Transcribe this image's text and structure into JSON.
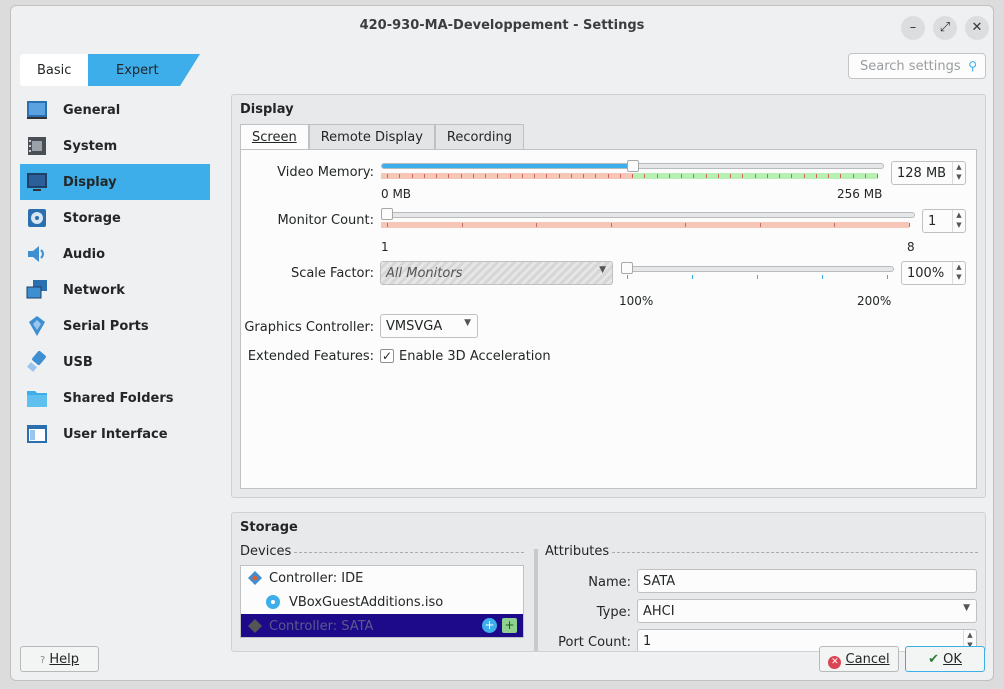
{
  "window": {
    "title": "420-930-MA-Developpement - Settings",
    "controls": {
      "minimize": "–",
      "maximize": "⤢",
      "close": "✕"
    }
  },
  "mode_tabs": {
    "basic": "Basic",
    "expert": "Expert",
    "selected": "Expert"
  },
  "search": {
    "placeholder": "Search settings"
  },
  "sidebar": {
    "items": [
      {
        "label": "General",
        "icon": "general-icon"
      },
      {
        "label": "System",
        "icon": "system-icon"
      },
      {
        "label": "Display",
        "icon": "display-icon",
        "selected": true
      },
      {
        "label": "Storage",
        "icon": "storage-icon"
      },
      {
        "label": "Audio",
        "icon": "audio-icon"
      },
      {
        "label": "Network",
        "icon": "network-icon"
      },
      {
        "label": "Serial Ports",
        "icon": "serial-ports-icon"
      },
      {
        "label": "USB",
        "icon": "usb-icon"
      },
      {
        "label": "Shared Folders",
        "icon": "shared-folders-icon"
      },
      {
        "label": "User Interface",
        "icon": "user-interface-icon"
      }
    ]
  },
  "display": {
    "title": "Display",
    "tabs": [
      "Screen",
      "Remote Display",
      "Recording"
    ],
    "active_tab": "Screen",
    "video_memory": {
      "label": "Video Memory:",
      "value": "128 MB",
      "min": "0 MB",
      "max": "256 MB",
      "fraction": 0.5
    },
    "monitor_count": {
      "label": "Monitor Count:",
      "value": "1",
      "min": "1",
      "max": "8",
      "fraction": 0.0
    },
    "scale_factor": {
      "label": "Scale Factor:",
      "combo": "All Monitors",
      "value": "100%",
      "min": "100%",
      "max": "200%",
      "fraction": 0.0
    },
    "graphics_controller": {
      "label": "Graphics Controller:",
      "value": "VMSVGA"
    },
    "extended_features": {
      "label": "Extended Features:",
      "checkbox_label": "Enable 3D Acceleration",
      "checked": true
    }
  },
  "storage": {
    "title": "Storage",
    "devices_label": "Devices",
    "attributes_label": "Attributes",
    "tree": [
      {
        "label": "Controller: IDE",
        "icon": "ide-controller-icon",
        "level": 0
      },
      {
        "label": "VBoxGuestAdditions.iso",
        "icon": "optical-disc-icon",
        "level": 1
      },
      {
        "label": "Controller: SATA",
        "icon": "sata-controller-icon",
        "level": 0,
        "selected": true
      }
    ],
    "attributes": {
      "name_label": "Name:",
      "name_value": "SATA",
      "type_label": "Type:",
      "type_value": "AHCI",
      "port_count_label": "Port Count:",
      "port_count_value": "1"
    }
  },
  "buttons": {
    "help": "Help",
    "cancel": "Cancel",
    "ok": "OK"
  },
  "colors": {
    "accent": "#3daee9",
    "selection_dark": "#1d0a8a",
    "zone_red": "#f6c6b8",
    "zone_green": "#b8f0b4"
  }
}
